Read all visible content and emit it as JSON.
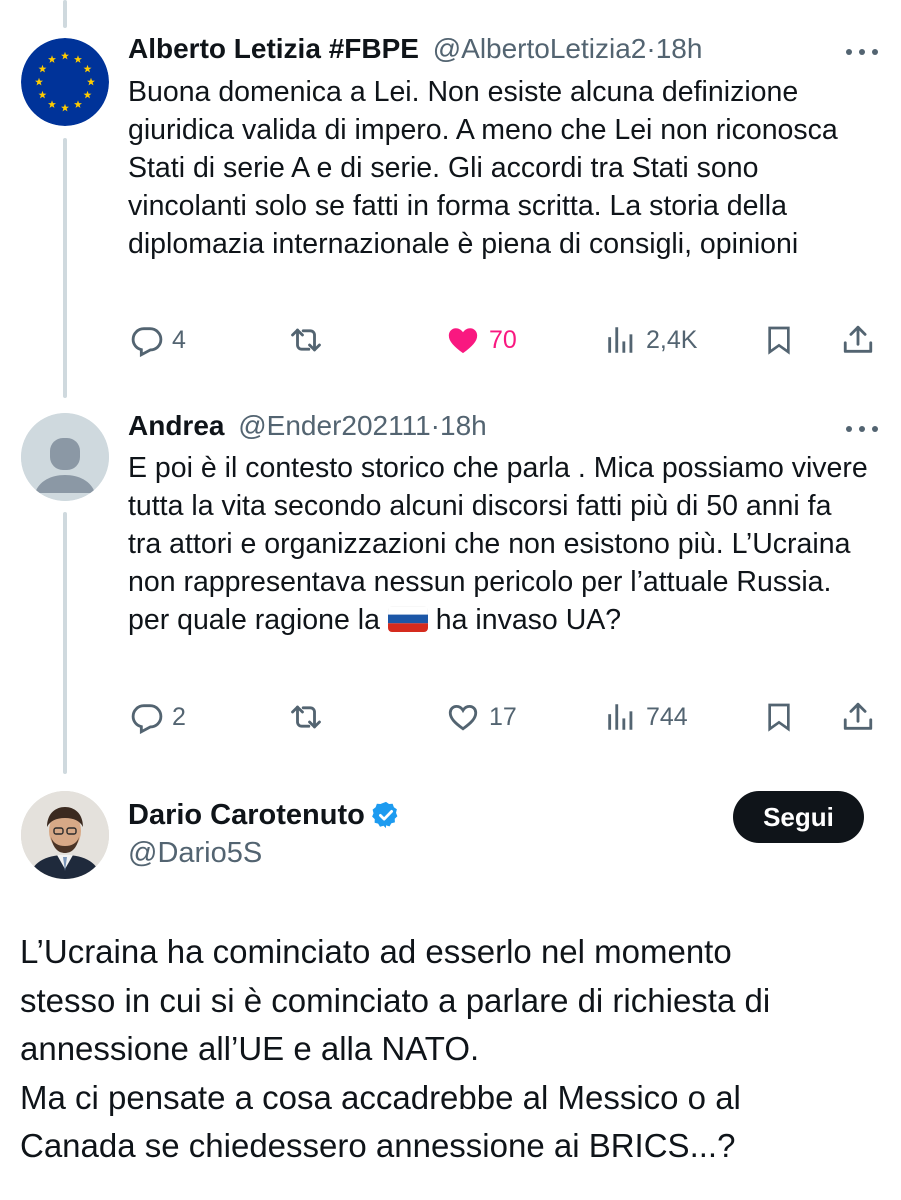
{
  "tweets": [
    {
      "name": "Alberto Letizia #FBPE",
      "handle": "@AlbertoLetizia2",
      "dot": "·",
      "time": "18h",
      "avatar_icon": "eu-flag-icon",
      "text": "Buona domenica a Lei. Non esiste alcuna definizione giuridica valida di impero. A meno che Lei non riconosca Stati di serie A e di serie. Gli accordi tra Stati sono vincolanti solo se fatti in forma scritta. La storia della diplomazia internazionale è piena di consigli, opinioni",
      "replies": "4",
      "retweets": "",
      "likes": "70",
      "liked": true,
      "views": "2,4K"
    },
    {
      "name": "Andrea",
      "handle": "@Ender202111",
      "dot": "·",
      "time": "18h",
      "avatar_icon": "default-avatar-icon",
      "text": "E poi è il contesto storico che parla . Mica possiamo vivere tutta la vita secondo alcuni discorsi fatti più di 50 anni fa tra attori e organizzazioni che non esistono più. L’Ucraina non rappresentava nessun pericolo per l’attuale Russia. per quale ragione la",
      "text_end_emoji": "russia-flag-icon",
      "text_after_emoji": "ha invaso UA?",
      "replies": "2",
      "retweets": "",
      "likes": "17",
      "liked": false,
      "views": "744"
    }
  ],
  "main_tweet": {
    "name": "Dario Carotenuto",
    "verified_icon": "verified-badge-icon",
    "handle": "@Dario5S",
    "follow_label": "Segui",
    "text_lines": [
      "L’Ucraina ha cominciato ad esserlo nel momento",
      "stesso in cui si è cominciato a parlare di richiesta di",
      "annessione all’UE e alla NATO.",
      "Ma ci pensate a cosa accadrebbe al Messico o al",
      "Canada se chiedessero annessione ai BRICS...?"
    ]
  },
  "colors": {
    "text": "#0f1419",
    "secondary": "#536471",
    "like": "#f91880",
    "verified": "#1d9bf0",
    "thread_line": "#cfd9de",
    "eu_blue": "#003399",
    "eu_star": "#ffcc00"
  }
}
